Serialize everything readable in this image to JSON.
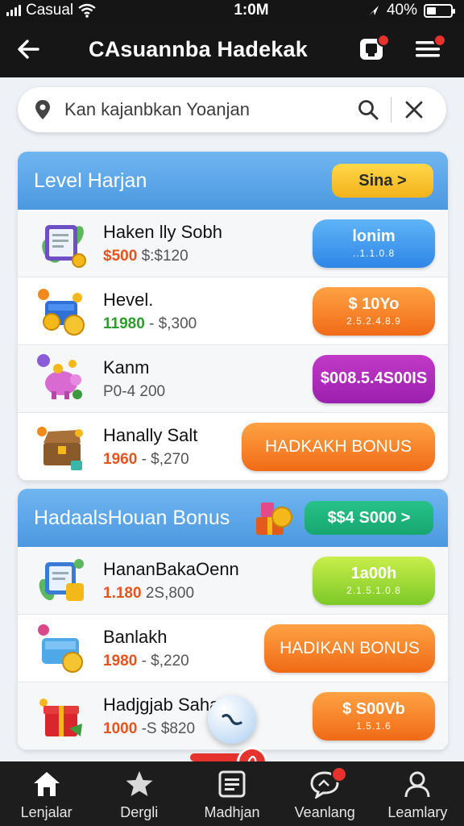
{
  "status_bar": {
    "carrier": "Casual",
    "time": "1:0M",
    "battery": "40%",
    "battery_level": 0.4
  },
  "header": {
    "title": "CAsuannba Hadekak",
    "back_icon": "arrow-left-icon",
    "notification_icon": "notification-icon",
    "menu_icon": "menu-icon"
  },
  "search": {
    "value": "Kan kajanbkan Yoanjan",
    "location_icon": "location-pin-icon",
    "search_icon": "search-icon",
    "clear_icon": "close-icon"
  },
  "sections": [
    {
      "title": "Level Harjan",
      "button_label": "Sina >",
      "items": [
        {
          "name": "Haken lly Sobh",
          "price": "$500",
          "range": "$:$120",
          "price_color": "#e4541e",
          "button": "lonim",
          "button_sub": "..1.1.0.8",
          "button_colors": [
            "#5fb4f7",
            "#2f86e6"
          ]
        },
        {
          "name": "Hevel.",
          "price": "11980",
          "range": "- $,300",
          "price_color": "#2e9b2e",
          "button": "$ 10Yo",
          "button_sub": "2.5.2.4.8.9",
          "button_colors": [
            "#ffa244",
            "#f06a16"
          ]
        },
        {
          "name": "Kanm",
          "price": "P0-4",
          "range": "200",
          "price_color": "#555555",
          "button": "$008.5.4S00IS",
          "button_sub": "",
          "button_colors": [
            "#c23ac7",
            "#9a1fae"
          ]
        },
        {
          "name": "Hanally Salt",
          "price": "1960",
          "range": "- $,270",
          "price_color": "#e4541e",
          "button": "HADKAKH BONUS",
          "button_sub": "",
          "button_colors": [
            "#ffa244",
            "#f06a16"
          ]
        }
      ]
    },
    {
      "title": "HadaalsHouan Bonus",
      "button_label": "$$4 S000 >",
      "items": [
        {
          "name": "HananBakaOenn",
          "price": "1.180",
          "range": "2S,800",
          "price_color": "#e4541e",
          "button": "1a00h",
          "button_sub": "2.1.5.1.0.8",
          "button_colors": [
            "#c9ee4a",
            "#7cc928"
          ]
        },
        {
          "name": "Banlakh",
          "price": "1980",
          "range": "- $,220",
          "price_color": "#e4541e",
          "button": "HADIKAN BONUS",
          "button_sub": "",
          "button_colors": [
            "#ffa244",
            "#f06a16"
          ]
        },
        {
          "name": "Hadjgjab Saharan",
          "price": "1000",
          "range": "-S $820",
          "price_color": "#e4541e",
          "button": "$ S00Vb",
          "button_sub": "1.5.1.6",
          "button_colors": [
            "#ffa244",
            "#f06a16"
          ]
        }
      ]
    }
  ],
  "bottom_nav": [
    {
      "label": "Lenjalar",
      "icon": "home-icon"
    },
    {
      "label": "Dergli",
      "icon": "star-icon"
    },
    {
      "label": "Madhjan",
      "icon": "list-icon"
    },
    {
      "label": "Veanlang",
      "icon": "chat-icon"
    },
    {
      "label": "Leamlary",
      "icon": "profile-icon"
    }
  ],
  "fab_icon": "refresh-icon"
}
